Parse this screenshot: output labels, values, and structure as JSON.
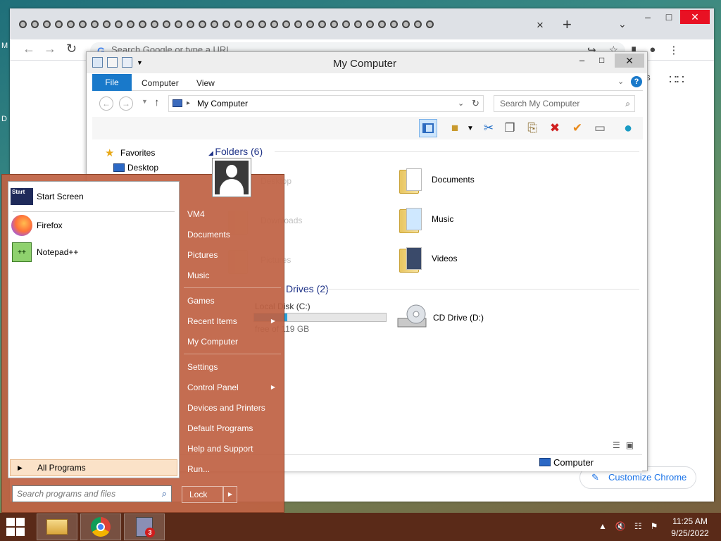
{
  "desktop": {
    "stub_letters": [
      "M",
      "D"
    ]
  },
  "chrome": {
    "tab_count": 35,
    "omnibox_placeholder": "Search Google or type a URL",
    "partial_text": "es",
    "customize_label": "Customize Chrome",
    "close_tab": "×",
    "new_tab": "+",
    "tab_list": "⌄"
  },
  "explorer": {
    "title": "My Computer",
    "tabs": {
      "file": "File",
      "computer": "Computer",
      "view": "View"
    },
    "address": "My Computer",
    "search_placeholder": "Search My Computer",
    "nav": {
      "favorites": "Favorites",
      "desktop": "Desktop"
    },
    "groups": {
      "folders": "Folders (6)",
      "drives": "Drives (2)"
    },
    "folders": [
      "Documents",
      "Music",
      "Videos"
    ],
    "hidden_folders_partial": [
      "Desktop",
      "Downloads",
      "Pictures"
    ],
    "drives": {
      "c_name": "Local Disk (C:)",
      "c_free": "free of 119 GB",
      "c_used_fraction": 0.25,
      "d_name": "CD Drive (D:)"
    },
    "status_label": "Computer"
  },
  "start_menu": {
    "programs": [
      "Start Screen",
      "Firefox",
      "Notepad++"
    ],
    "start_screen_icon_text": "Start",
    "all_programs": "All Programs",
    "search_placeholder": "Search programs and files",
    "right_items": [
      "VM4",
      "Documents",
      "Pictures",
      "Music",
      "Games",
      "Recent Items",
      "My Computer",
      "Settings",
      "Control Panel",
      "Devices and Printers",
      "Default Programs",
      "Help and Support",
      "Run..."
    ],
    "lock_label": "Lock"
  },
  "taskbar": {
    "badge_count": "3",
    "time": "11:25 AM",
    "date": "9/25/2022"
  },
  "colors": {
    "start_menu_bg": "#bf6244",
    "taskbar_bg": "#5a2a18",
    "accent": "#1979ca"
  }
}
